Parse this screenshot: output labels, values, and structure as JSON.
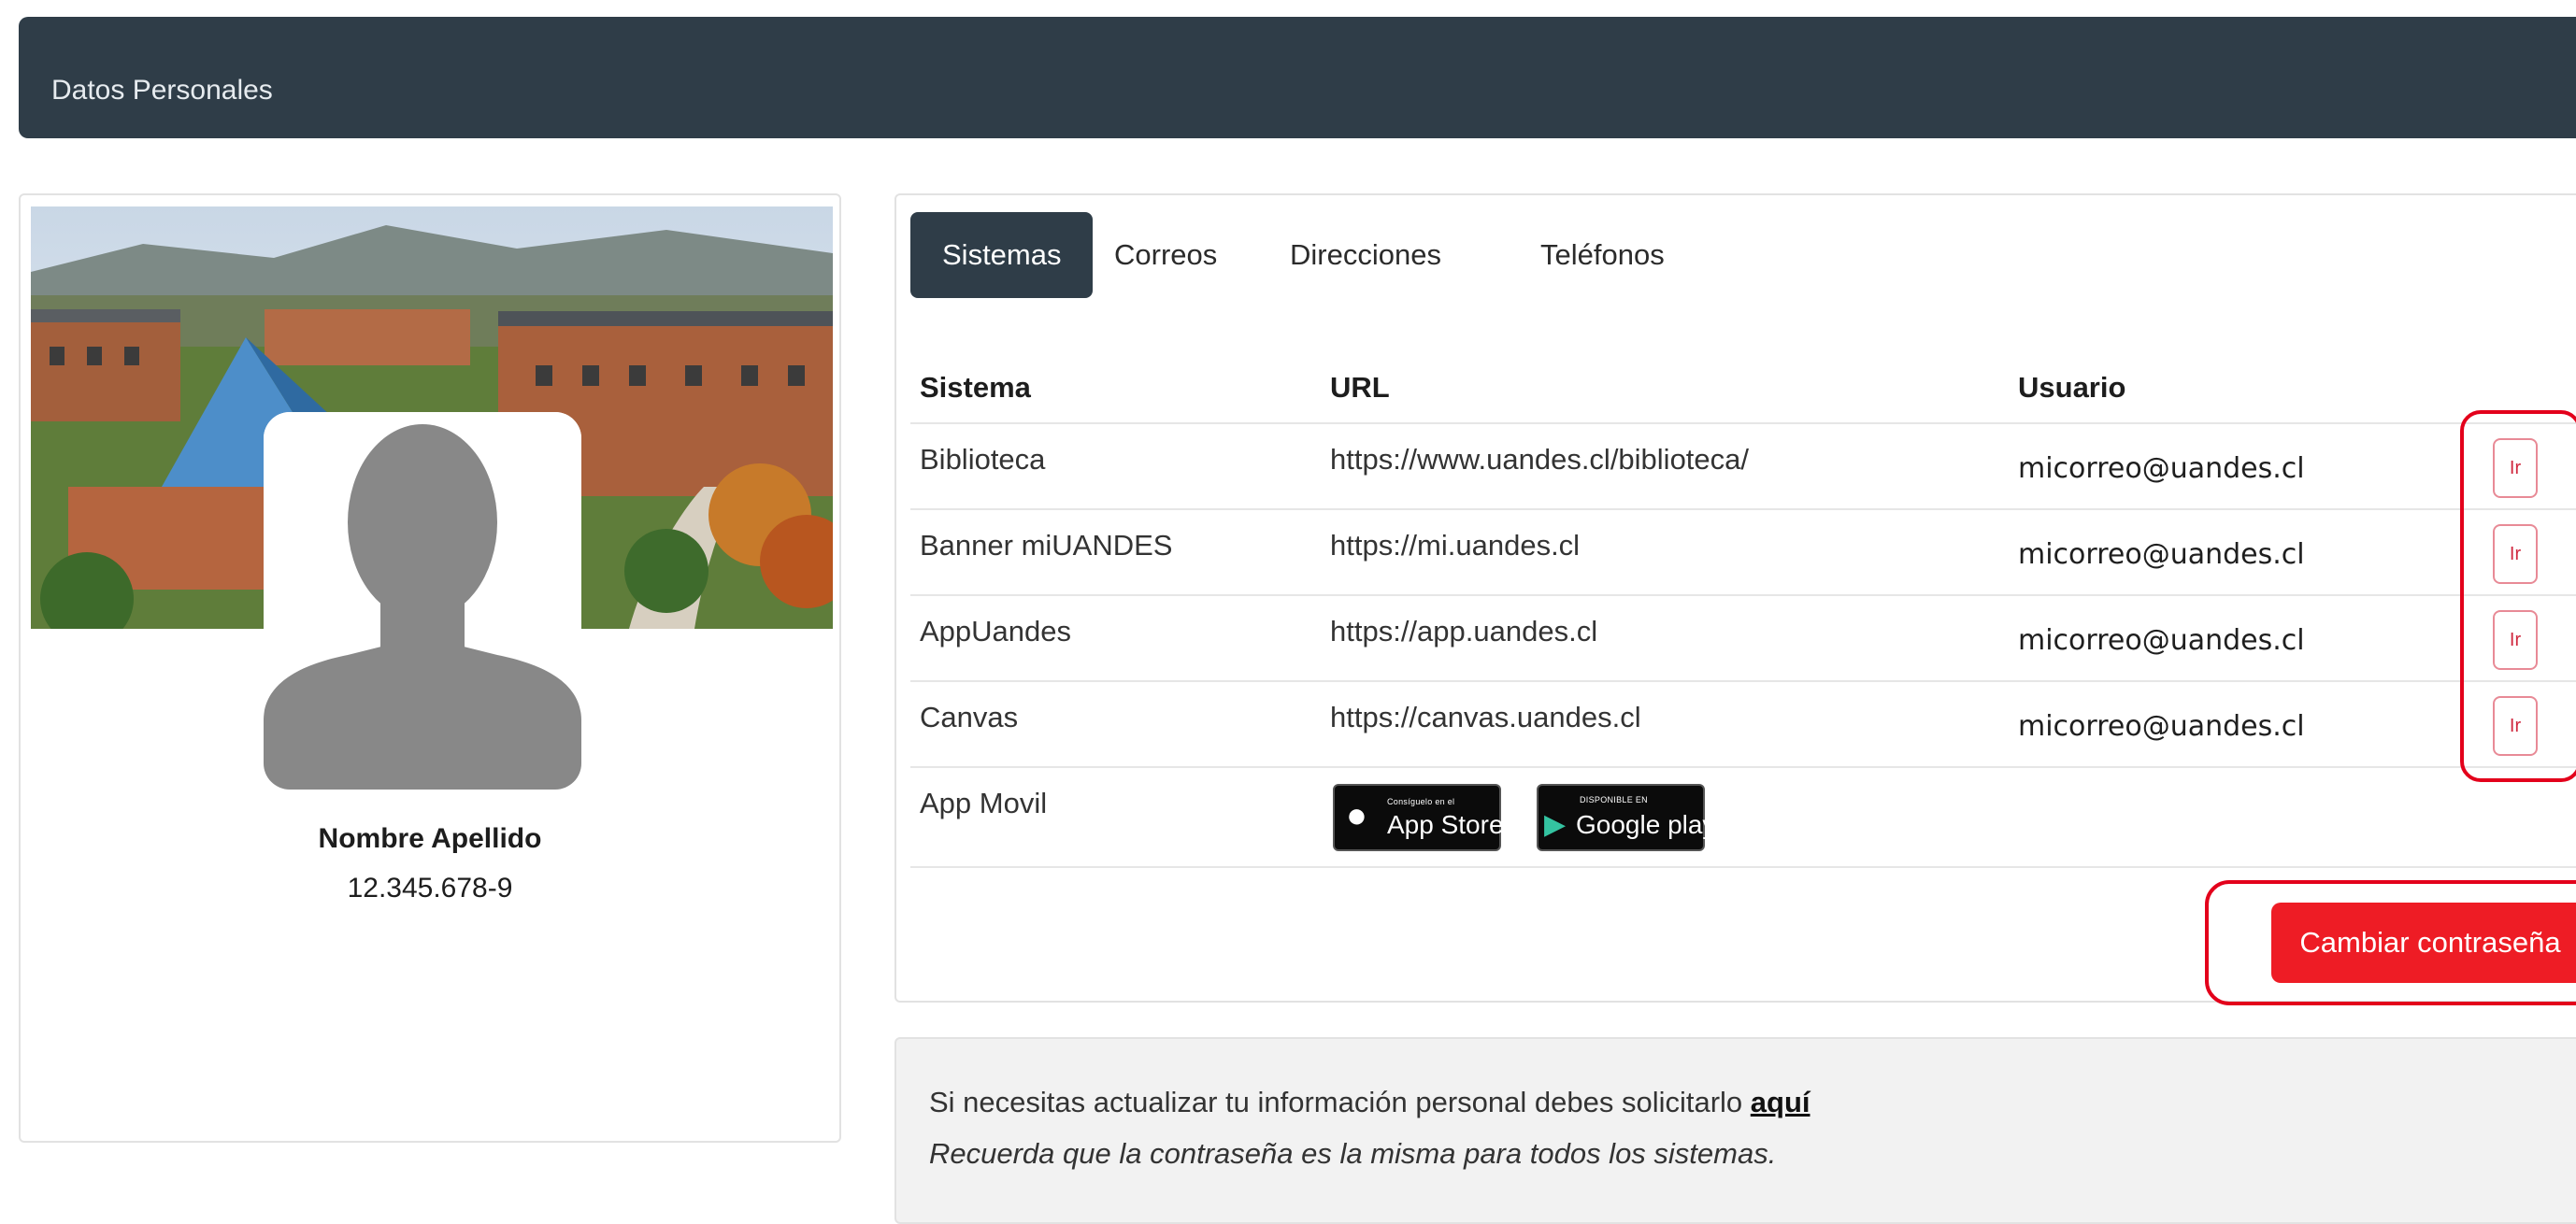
{
  "header": {
    "title": "Datos Personales"
  },
  "profile": {
    "name": "Nombre Apellido",
    "id": "12.345.678-9"
  },
  "tabs": [
    {
      "label": "Sistemas",
      "active": true
    },
    {
      "label": "Correos",
      "active": false
    },
    {
      "label": "Direcciones",
      "active": false
    },
    {
      "label": "Teléfonos",
      "active": false
    }
  ],
  "table": {
    "headers": {
      "system": "Sistema",
      "url": "URL",
      "user": "Usuario"
    },
    "rows": [
      {
        "system": "Biblioteca",
        "url": "https://www.uandes.cl/biblioteca/",
        "user": "micorreo@uandes.cl",
        "action": "Ir"
      },
      {
        "system": "Banner miUANDES",
        "url": "https://mi.uandes.cl",
        "user": "micorreo@uandes.cl",
        "action": "Ir"
      },
      {
        "system": "AppUandes",
        "url": "https://app.uandes.cl",
        "user": "micorreo@uandes.cl",
        "action": "Ir"
      },
      {
        "system": "Canvas",
        "url": "https://canvas.uandes.cl",
        "user": "micorreo@uandes.cl",
        "action": "Ir"
      }
    ],
    "app_row": {
      "system": "App Movil",
      "app_store": {
        "small": "Consíguelo en el",
        "big": "App Store"
      },
      "google_play": {
        "small": "DISPONIBLE EN",
        "big": "Google play"
      }
    }
  },
  "change_password": {
    "label": "Cambiar contraseña"
  },
  "info": {
    "line1_prefix": "Si necesitas actualizar tu información personal debes solicitarlo ",
    "line1_link": "aquí",
    "line2": "Recuerda que la contraseña es la misma para todos los sistemas."
  },
  "colors": {
    "header_bg": "#2f3d48",
    "accent_red": "#ee1c25",
    "highlight_red": "#e3001b"
  }
}
